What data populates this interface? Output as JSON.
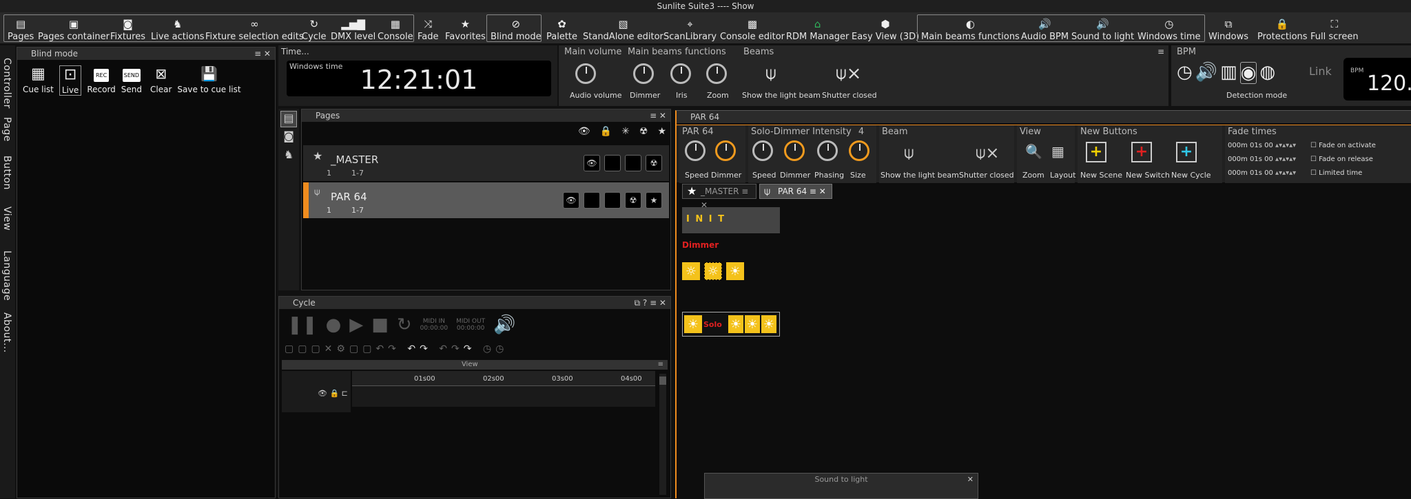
{
  "title": "Sunlite Suite3 ---- Show",
  "toolbar": {
    "pages": "Pages",
    "pages_container": "Pages container",
    "fixtures": "Fixtures",
    "live_actions": "Live actions",
    "fixture_selection_edits": "Fixture selection edits",
    "cycle": "Cycle",
    "dmx_level": "DMX level",
    "console": "Console",
    "fade": "Fade",
    "favorites": "Favorites",
    "blind_mode": "Blind mode",
    "palette": "Palette",
    "standalone_editor": "StandAlone editor",
    "scanlibrary": "ScanLibrary",
    "console_editor": "Console editor",
    "rdm_manager": "RDM Manager",
    "easy_view": "Easy View (3D)",
    "main_beams_functions": "Main beams functions",
    "audio_bpm": "Audio BPM",
    "sound_to_light": "Sound to light",
    "windows_time": "Windows time",
    "windows": "Windows",
    "protections": "Protections",
    "full_screen": "Full screen"
  },
  "side_tabs": [
    "Controller",
    "Page",
    "Button",
    "View",
    "Language",
    "About..."
  ],
  "blind": {
    "title": "Blind mode",
    "cue_list": "Cue list",
    "live": "Live",
    "record": "Record",
    "send": "Send",
    "clear": "Clear",
    "save_to_cue_list": "Save to cue list",
    "rec_icon": "REC",
    "send_icon": "SEND"
  },
  "time": {
    "title": "Time...",
    "label": "Windows time",
    "value": "12:21:01"
  },
  "main_volume": {
    "title": "Main volume",
    "audio_volume": "Audio volume"
  },
  "main_beams": {
    "title": "Main beams functions",
    "dimmer": "Dimmer",
    "iris": "Iris",
    "zoom": "Zoom"
  },
  "beams": {
    "title": "Beams",
    "show_light_beam": "Show the light beam",
    "shutter_closed": "Shutter closed"
  },
  "bpm": {
    "title": "BPM",
    "detection_mode": "Detection mode",
    "label": "BPM",
    "value": "120.",
    "link": "Link"
  },
  "pages": {
    "title": "Pages",
    "items": [
      {
        "name": "_MASTER",
        "num": "1",
        "range": "1-7"
      },
      {
        "name": "PAR 64",
        "num": "1",
        "range": "1-7"
      }
    ]
  },
  "cycle": {
    "title": "Cycle",
    "midi_in": "MIDI IN",
    "midi_out": "MIDI OUT",
    "midi_in_time": "00:00:00",
    "midi_out_time": "00:00:00",
    "view": "View",
    "ticks": [
      "01s00",
      "02s00",
      "03s00",
      "04s00"
    ]
  },
  "par64": {
    "title": "PAR 64",
    "sec1": {
      "title": "PAR 64",
      "speed": "Speed",
      "dimmer": "Dimmer"
    },
    "sec2": {
      "title": "Solo-Dimmer Intensity",
      "count": "4",
      "speed": "Speed",
      "dimmer": "Dimmer",
      "phasing": "Phasing",
      "size": "Size"
    },
    "beam": {
      "title": "Beam",
      "show_light_beam": "Show the light beam",
      "shutter_closed": "Shutter closed"
    },
    "view": {
      "title": "View",
      "zoom": "Zoom",
      "layout": "Layout"
    },
    "new_buttons": {
      "title": "New Buttons",
      "new_scene": "New Scene",
      "new_switch": "New Switch",
      "new_cycle": "New Cycle"
    },
    "fade": {
      "title": "Fade times",
      "t1": "000m 01s 00",
      "t2": "000m 01s 00",
      "t3": "000m 01s 00",
      "activate": "Fade on activate",
      "release": "Fade on release",
      "limited": "Limited time"
    },
    "tabs": [
      "_MASTER",
      "PAR 64"
    ],
    "init": "I N I T",
    "dimmer": "Dimmer",
    "solo": "Solo"
  },
  "sound_to_light": {
    "title": "Sound to light"
  }
}
